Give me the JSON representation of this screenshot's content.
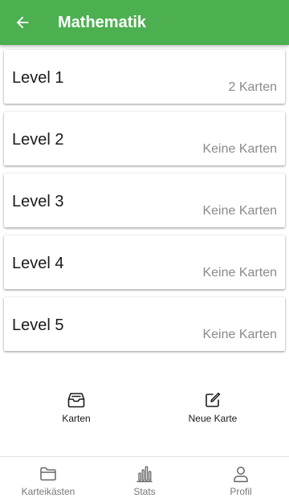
{
  "appbar": {
    "title": "Mathematik",
    "back_icon": "arrow-left-icon",
    "color": "#4caf50"
  },
  "levels": [
    {
      "title": "Level 1",
      "count": "2 Karten"
    },
    {
      "title": "Level 2",
      "count": "Keine Karten"
    },
    {
      "title": "Level 3",
      "count": "Keine Karten"
    },
    {
      "title": "Level 4",
      "count": "Keine Karten"
    },
    {
      "title": "Level 5",
      "count": "Keine Karten"
    }
  ],
  "actions": {
    "karten": {
      "label": "Karten",
      "icon": "inbox-icon"
    },
    "neue_karte": {
      "label": "Neue Karte",
      "icon": "edit-icon"
    }
  },
  "bottom_nav": [
    {
      "label": "Karteikästen",
      "icon": "folder-icon"
    },
    {
      "label": "Stats",
      "icon": "bar-chart-icon"
    },
    {
      "label": "Profil",
      "icon": "user-icon"
    }
  ]
}
